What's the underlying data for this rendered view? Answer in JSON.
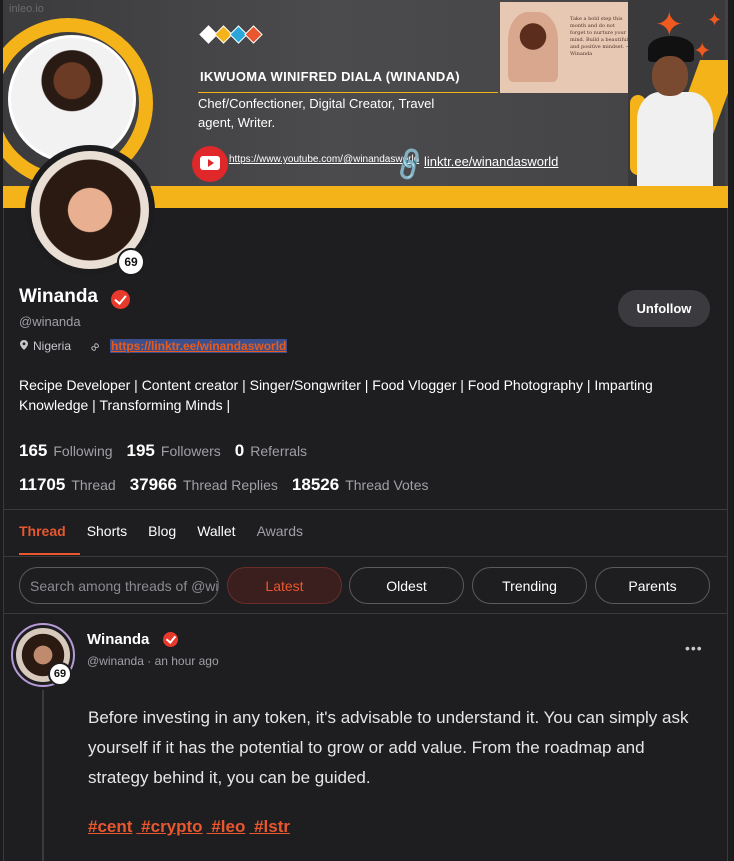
{
  "banner": {
    "watermark": "inleo.io",
    "full_name": "IKWUOMA WINIFRED DIALA (WINANDA)",
    "description": "Chef/Confectioner, Digital Creator, Travel agent, Writer.",
    "youtube_url": "https://www.youtube.com/@winandasworld",
    "linktree_text": "linktr.ee/winandasworld",
    "quote_text": "Take a bold step this month and do not forget to nurture your mind. Build a beautiful and positive mindset. ~ Winanda",
    "diamond_colors": [
      "#ffffff",
      "#f5b31a",
      "#2aa7d8",
      "#e8572e"
    ]
  },
  "profile": {
    "avatar_level": "69",
    "name": "Winanda",
    "handle": "@winanda",
    "unfollow_label": "Unfollow",
    "location": "Nigeria",
    "link": "https://linktr.ee/winandasworld",
    "bio": "Recipe Developer | Content creator | Singer/Songwriter | Food Vlogger | Food Photography | Imparting Knowledge | Transforming Minds |"
  },
  "stats": {
    "row1": [
      {
        "value": "165",
        "label": "Following"
      },
      {
        "value": "195",
        "label": "Followers"
      },
      {
        "value": "0",
        "label": "Referrals"
      }
    ],
    "row2": [
      {
        "value": "11705",
        "label": "Thread"
      },
      {
        "value": "37966",
        "label": "Thread Replies"
      },
      {
        "value": "18526",
        "label": "Thread Votes"
      }
    ]
  },
  "tabs": {
    "thread": "Thread",
    "shorts": "Shorts",
    "blog": "Blog",
    "wallet": "Wallet",
    "awards": "Awards"
  },
  "filters": {
    "search_placeholder": "Search among threads of @winanda",
    "latest": "Latest",
    "oldest": "Oldest",
    "trending": "Trending",
    "parents": "Parents"
  },
  "post": {
    "avatar_level": "69",
    "author": "Winanda",
    "handle": "@winanda",
    "separator": "·",
    "time": "an hour ago",
    "more": "•••",
    "body": "Before investing in any token, it's advisable to understand it. You can simply ask yourself if it has the potential to grow or add value. From the roadmap and strategy behind it, you can be guided.",
    "tags": [
      "#cent",
      "#crypto",
      "#leo",
      "#lstr"
    ]
  },
  "colors": {
    "accent": "#e8572e",
    "banner_yellow": "#f5b31a",
    "verified_red": "#e83a2c",
    "background": "#1e1e21"
  }
}
